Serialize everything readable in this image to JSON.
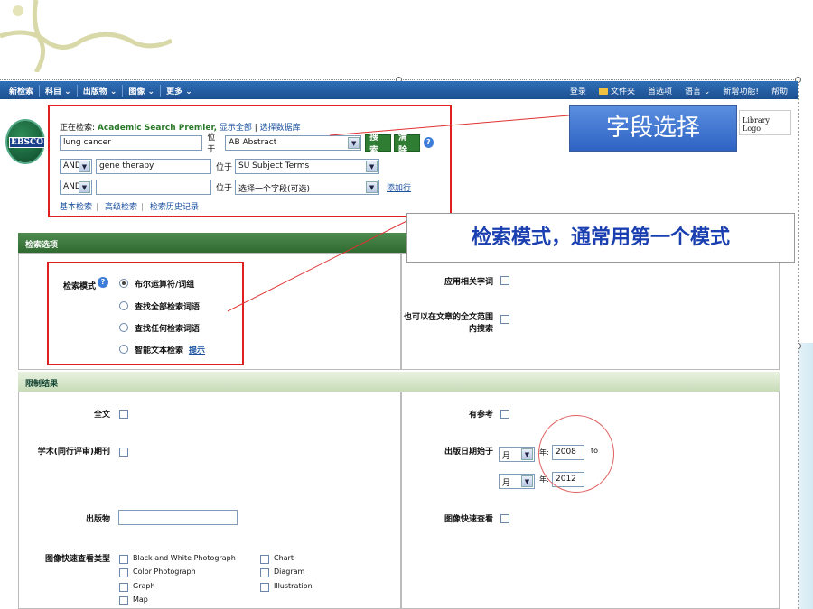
{
  "topbar": {
    "nav": [
      "新检索",
      "科目 ⌄",
      "出版物 ⌄",
      "图像 ⌄",
      "更多 ⌄"
    ],
    "right": [
      "登录",
      "文件夹",
      "首选项",
      "语言 ⌄",
      "新增功能!",
      "帮助"
    ]
  },
  "logo": {
    "text": "EBSCO"
  },
  "library_logo": "Library Logo",
  "search": {
    "searching_prefix": "正在检索:",
    "database": "Academic Search Premier,",
    "show_all": "显示全部",
    "choose_db": "选择数据库",
    "in_label": "位于",
    "rows": [
      {
        "op": "",
        "term": "lung cancer",
        "field": "AB Abstract"
      },
      {
        "op": "AND",
        "term": "gene therapy",
        "field": "SU Subject Terms"
      },
      {
        "op": "AND",
        "term": "",
        "field": "选择一个字段(可选)"
      }
    ],
    "search_btn": "搜索",
    "clear_btn": "清除",
    "add_row": "添加行",
    "links": [
      "基本检索",
      "高级检索",
      "检索历史记录"
    ]
  },
  "options": {
    "header": "检索选项",
    "mode_label": "检索模式",
    "modes": [
      "布尔运算符/词组",
      "查找全部检索词语",
      "查找任何检索词语",
      "智能文本检索"
    ],
    "selected_mode": 0,
    "hint": "提示",
    "related_words": "应用相关字词",
    "fulltext_search": "也可以在文章的全文范围内搜索"
  },
  "limits": {
    "header": "限制结果",
    "full_text": "全文",
    "has_refs": "有参考",
    "peer_reviewed": "学术(同行评审)期刊",
    "pub_date": "出版日期始于",
    "month": "月",
    "year_label": "年:",
    "year_from": "2008",
    "year_to": "2012",
    "to": "to",
    "publication": "出版物",
    "image_quick": "图像快速查看",
    "image_types_label": "图像快速查看类型",
    "image_types_col1": [
      "Black and White Photograph",
      "Color Photograph",
      "Graph",
      "Map"
    ],
    "image_types_col2": [
      "Chart",
      "Diagram",
      "Illustration"
    ]
  },
  "annotations": {
    "field_select": "字段选择",
    "mode_note": "检索模式，通常用第一个模式"
  }
}
